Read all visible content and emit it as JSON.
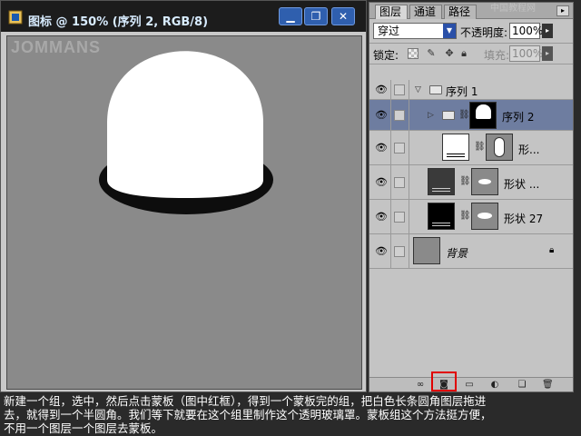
{
  "document": {
    "title": "图标 @ 150% (序列 2, RGB/8)",
    "window_buttons": [
      "▁",
      "❐",
      "✕"
    ],
    "watermark_text": "JOMMANS"
  },
  "colors": {
    "titlebar": "#1c1c1c",
    "canvas_bg": "#8a8a8a",
    "selected_row": "#6e7da0",
    "highlight": "#e00000",
    "window_button": "#2f5fae"
  },
  "panel": {
    "tabs": [
      "图层",
      "通道",
      "路径"
    ],
    "blend_mode": "穿过",
    "opacity_label": "不透明度:",
    "opacity_value": "100%",
    "lock_label": "锁定:",
    "fill_label": "填充:",
    "fill_value": "100%",
    "layers": [
      {
        "name": "序列 1",
        "kind": "group",
        "expanded": true
      },
      {
        "name": "序列 2",
        "kind": "group",
        "expanded": false,
        "selected": true
      },
      {
        "name": "形...",
        "kind": "shape"
      },
      {
        "name": "形状 ...",
        "kind": "shape"
      },
      {
        "name": "形状 27",
        "kind": "shape"
      },
      {
        "name": "背景",
        "kind": "background",
        "locked": true
      }
    ],
    "bottom_icons": [
      "link-layers-icon",
      "add-layer-mask-icon",
      "new-group-icon",
      "adjustment-layer-icon",
      "new-layer-icon",
      "trash-icon"
    ]
  },
  "site_watermark": "中国教程网",
  "caption": {
    "line1": "新建一个组，选中，然后点击蒙板（图中红框），得到一个蒙板完的组，把白色长条圆角图层拖进",
    "line2": "去，就得到一个半圆角。我们等下就要在这个组里制作这个透明玻璃罩。蒙板组这个方法挺方便，",
    "line3": "不用一个图层一个图层去蒙板。"
  }
}
